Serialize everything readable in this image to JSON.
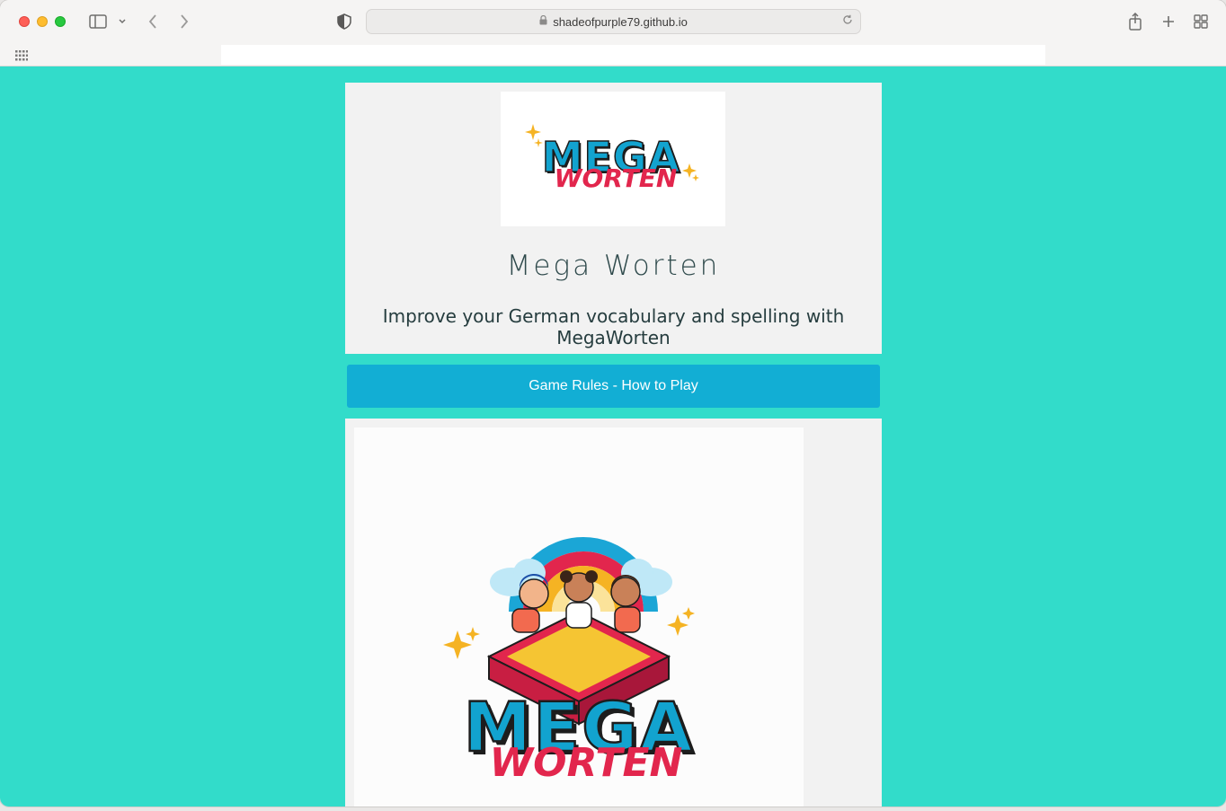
{
  "browser": {
    "url": "shadeofpurple79.github.io",
    "icons": [
      "sidebar-toggle-icon",
      "chevron-down-icon",
      "back-arrow-icon",
      "forward-arrow-icon",
      "shield-icon",
      "lock-icon",
      "reload-icon",
      "share-icon",
      "new-tab-plus-icon",
      "tab-overview-icon",
      "favorites-grid-icon"
    ]
  },
  "page": {
    "background_color": "#32dcca",
    "header": {
      "logo_text_top": "MEGA",
      "logo_text_bottom": "WORTEN",
      "title": "Mega Worten",
      "tagline": "Improve your German vocabulary and spelling with MegaWorten"
    },
    "rules_button": {
      "label": "Game Rules - How to Play",
      "color": "#12aed4"
    },
    "game_image": {
      "logo_text_top": "MEGA",
      "logo_text_bottom": "WORTEN"
    }
  }
}
